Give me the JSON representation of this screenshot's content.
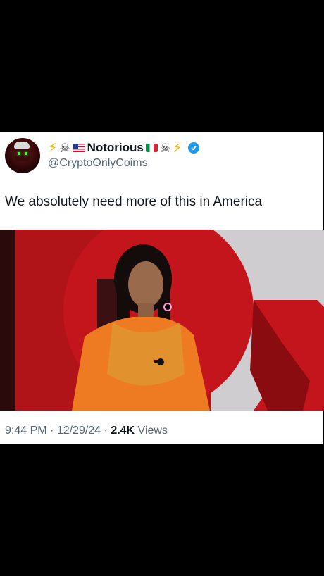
{
  "author": {
    "display_name": "Notorious",
    "handle": "@CryptoOnlyCoims",
    "verified": true,
    "decorations": [
      "lightning-icon",
      "skull-crossbones-icon",
      "us-flag-icon",
      "italy-flag-icon",
      "skull-crossbones-icon",
      "lightning-icon"
    ]
  },
  "tweet": {
    "text": "We absolutely need more of this in America"
  },
  "media": {
    "type": "video-frame",
    "description_icon": "speaker-on-stage-image"
  },
  "meta": {
    "time": "9:44 PM",
    "sep1": " · ",
    "date": "12/29/24",
    "sep2": " · ",
    "views_count": "2.4K",
    "views_label": " Views"
  },
  "colors": {
    "background": "#000000",
    "card": "#ffffff",
    "text_primary": "#0f1419",
    "text_secondary": "#536471",
    "verified_blue": "#1d9bf0",
    "stage_red": "#c4151c",
    "shirt_orange": "#ee7a22"
  }
}
